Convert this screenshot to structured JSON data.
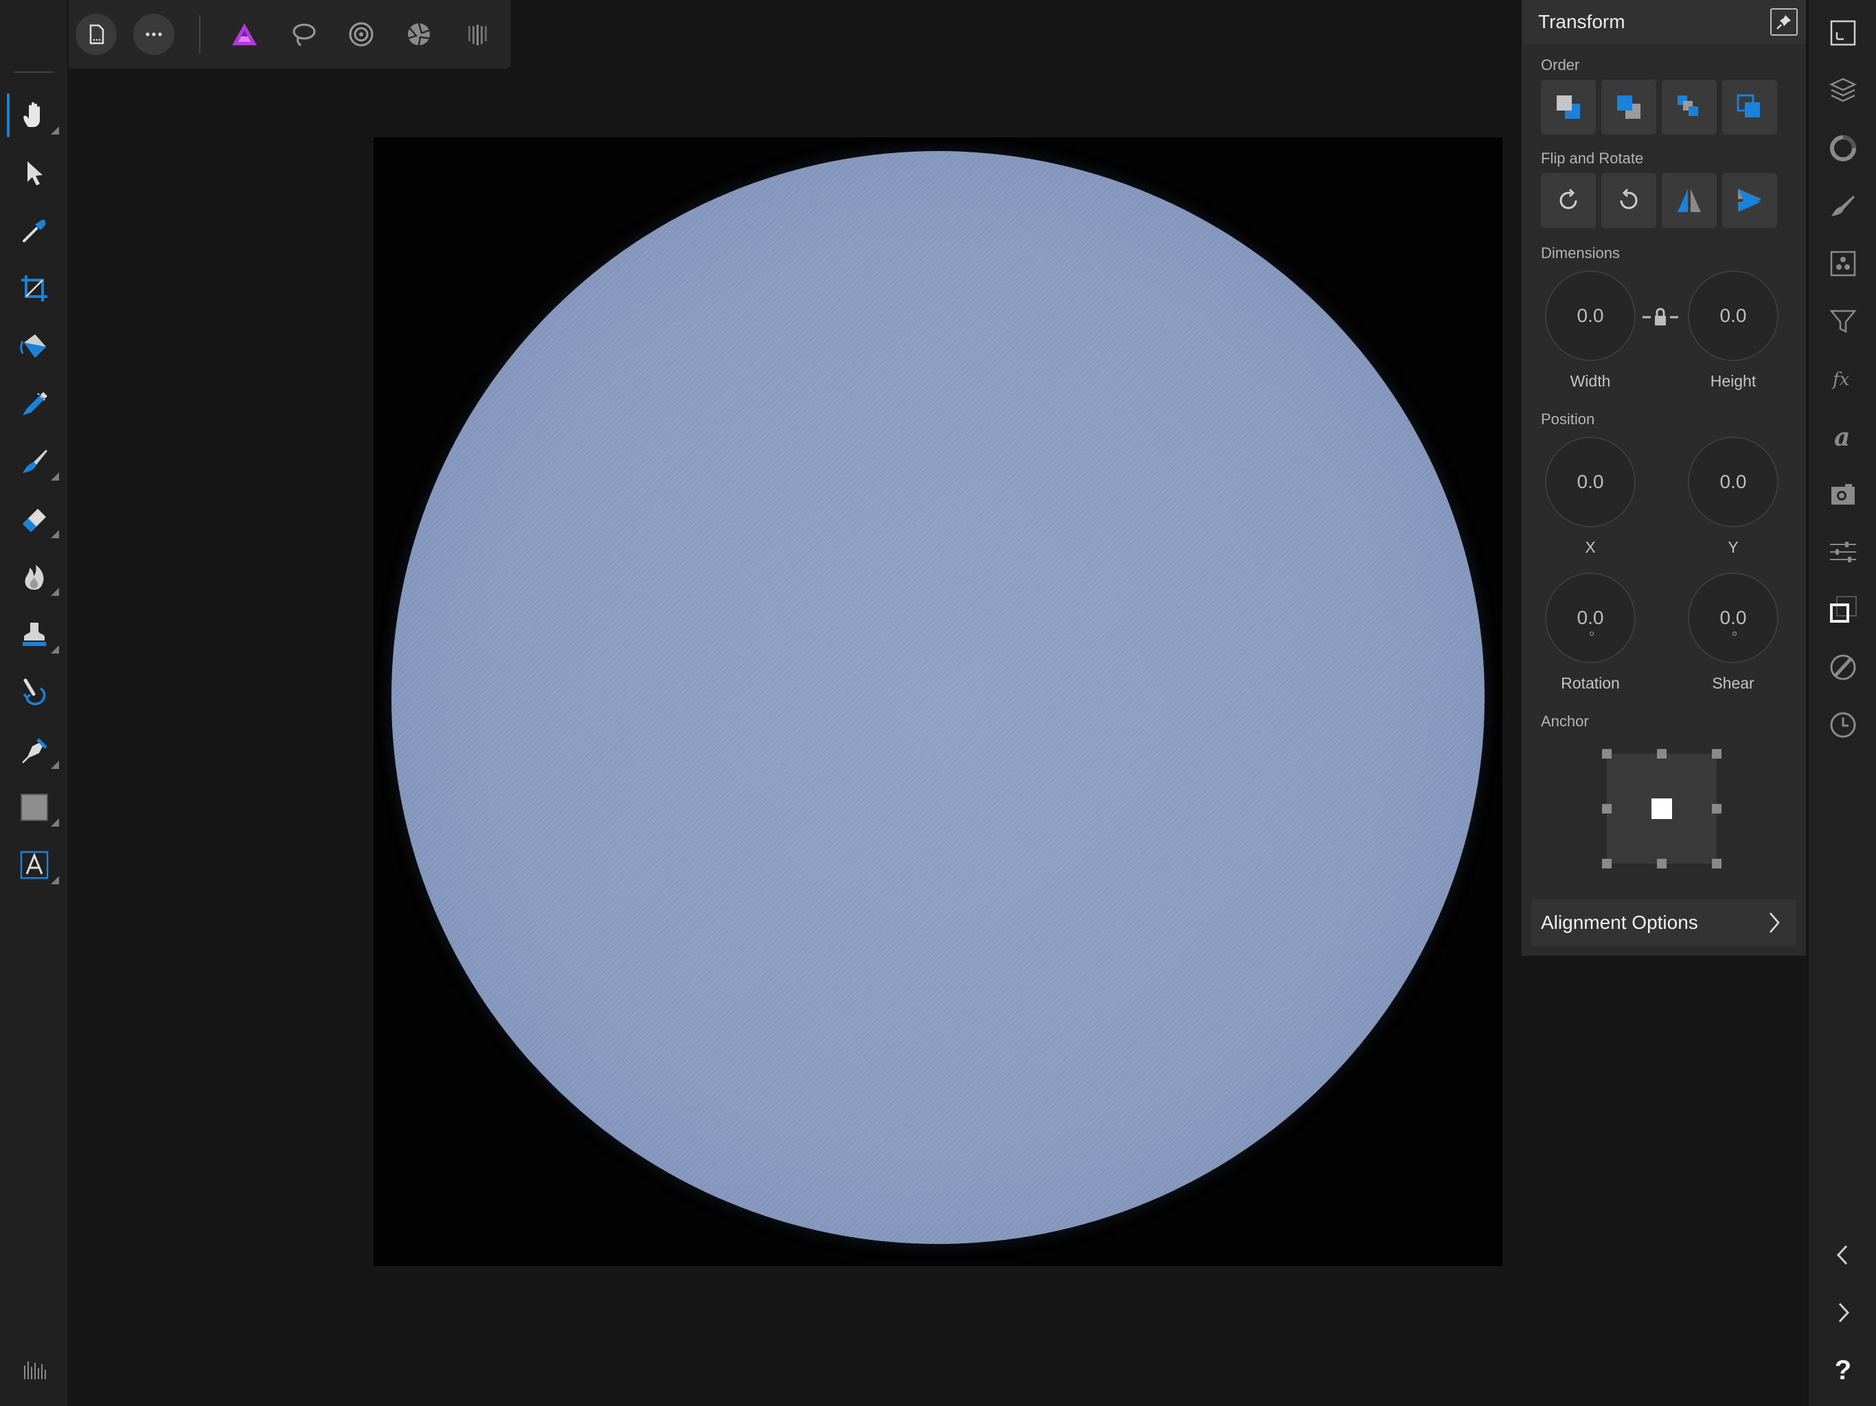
{
  "app": {
    "top_toolbar": {
      "icons": [
        "back-arrow-icon",
        "document-icon",
        "more-icon",
        "photo-persona-icon",
        "selection-persona-icon",
        "liquify-persona-icon",
        "develop-persona-icon",
        "tone-mapping-persona-icon"
      ]
    },
    "left_tools": [
      "hand-tool-icon",
      "move-tool-icon",
      "color-picker-icon",
      "crop-icon",
      "flood-fill-icon",
      "selection-brush-icon",
      "paint-brush-icon",
      "erase-brush-icon",
      "burn-icon",
      "clone-stamp-icon",
      "blemish-removal-icon",
      "pen-icon",
      "rectangle-icon",
      "text-icon"
    ],
    "bottom_left_icon": "histogram-icon",
    "right_tools": [
      "transform-panel-icon",
      "layers-icon",
      "adjustments-icon",
      "brushes-icon",
      "channels-icon",
      "filters-icon",
      "effects-icon",
      "text-styles-icon",
      "snapshots-icon",
      "sliders-icon",
      "navigator-icon",
      "block-icon",
      "history-icon"
    ],
    "right_bottom_icons": [
      "collapse-left-icon",
      "expand-right-icon",
      "help-icon"
    ],
    "help_label": "?"
  },
  "transform": {
    "title": "Transform",
    "order_label": "Order",
    "flip_label": "Flip and Rotate",
    "dimensions_label": "Dimensions",
    "width_value": "0.0",
    "width_label": "Width",
    "height_value": "0.0",
    "height_label": "Height",
    "position_label": "Position",
    "x_value": "0.0",
    "x_label": "X",
    "y_value": "0.0",
    "y_label": "Y",
    "rotation_value": "0.0",
    "rotation_label": "Rotation",
    "shear_value": "0.0",
    "shear_label": "Shear",
    "anchor_label": "Anchor",
    "alignment_label": "Alignment Options"
  },
  "colors": {
    "accent": "#1a82d8",
    "panel": "#2b2b2b",
    "canvas_bg": "#161616",
    "sun": "#8c9fc5"
  }
}
